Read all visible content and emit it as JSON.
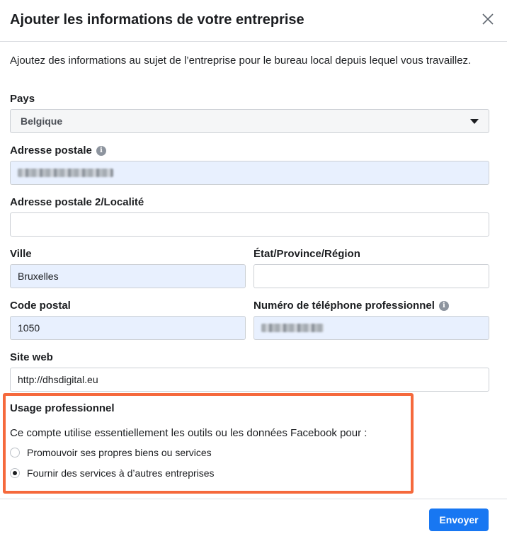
{
  "dialog": {
    "title": "Ajouter les informations de votre entreprise",
    "close_icon": "close-icon",
    "intro": "Ajoutez des informations au sujet de l’entreprise pour le bureau local depuis lequel vous travaillez."
  },
  "form": {
    "country": {
      "label": "Pays",
      "value": "Belgique"
    },
    "address": {
      "label": "Adresse postale",
      "value": "",
      "info_icon": "info-icon"
    },
    "address2": {
      "label": "Adresse postale 2/Localité",
      "value": ""
    },
    "city": {
      "label": "Ville",
      "value": "Bruxelles"
    },
    "state": {
      "label": "État/Province/Région",
      "value": ""
    },
    "postal_code": {
      "label": "Code postal",
      "value": "1050"
    },
    "phone": {
      "label": "Numéro de téléphone professionnel",
      "value": "",
      "info_icon": "info-icon"
    },
    "website": {
      "label": "Site web",
      "value": "http://dhsdigital.eu"
    }
  },
  "usage": {
    "title": "Usage professionnel",
    "question": "Ce compte utilise essentiellement les outils ou les données Facebook pour :",
    "options": [
      {
        "label": "Promouvoir ses propres biens ou services",
        "selected": false
      },
      {
        "label": "Fournir des services à d’autres entreprises",
        "selected": true
      }
    ]
  },
  "footer": {
    "submit_label": "Envoyer"
  },
  "colors": {
    "accent": "#1877f2",
    "highlight": "#f5693c",
    "autofill": "#e8f0fe"
  }
}
